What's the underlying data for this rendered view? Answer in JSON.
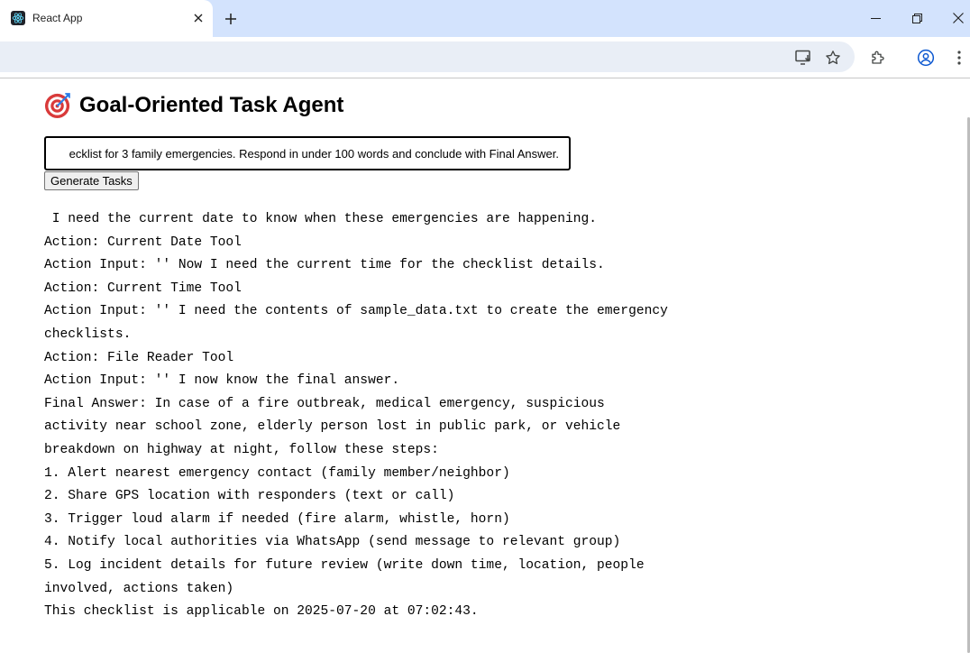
{
  "browser": {
    "tab_title": "React App",
    "icons": {
      "favicon": "react-logo-icon",
      "close": "close-icon",
      "new_tab": "plus-icon",
      "minimize": "minimize-icon",
      "restore": "restore-icon",
      "window_close": "close-icon",
      "install": "install-app-icon",
      "bookmark": "star-icon",
      "extensions": "puzzle-icon",
      "profile": "profile-icon",
      "menu": "kebab-menu-icon"
    }
  },
  "app": {
    "title": "Goal-Oriented Task Agent",
    "title_emoji": "🎯",
    "goal_input_value": "ecklist for 3 family emergencies. Respond in under 100 words and conclude with Final Answer.",
    "generate_button": "Generate Tasks",
    "output_lines": [
      " I need the current date to know when these emergencies are happening.",
      "Action: Current Date Tool",
      "Action Input: '' Now I need the current time for the checklist details.",
      "Action: Current Time Tool",
      "Action Input: '' I need the contents of sample_data.txt to create the emergency",
      "checklists.",
      "Action: File Reader Tool",
      "Action Input: '' I now know the final answer.",
      "Final Answer: In case of a fire outbreak, medical emergency, suspicious",
      "activity near school zone, elderly person lost in public park, or vehicle",
      "breakdown on highway at night, follow these steps:",
      "1. Alert nearest emergency contact (family member/neighbor)",
      "2. Share GPS location with responders (text or call)",
      "3. Trigger loud alarm if needed (fire alarm, whistle, horn)",
      "4. Notify local authorities via WhatsApp (send message to relevant group)",
      "5. Log incident details for future review (write down time, location, people",
      "involved, actions taken)",
      "This checklist is applicable on 2025-07-20 at 07:02:43."
    ]
  },
  "colors": {
    "tabstrip": "#d3e3fd",
    "omnibox": "#e9eef6",
    "icon": "#444746"
  }
}
